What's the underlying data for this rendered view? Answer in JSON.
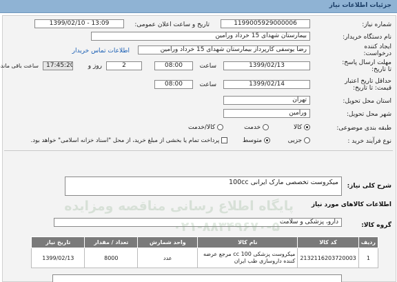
{
  "header": {
    "title": "جزئیات اطلاعات نیاز"
  },
  "form": {
    "need_number_label": "شماره نیاز:",
    "need_number": "1199005929000006",
    "announce_label": "تاریخ و ساعت اعلان عمومی:",
    "announce_value": "1399/02/10 - 13:09",
    "buyer_org_label": "نام دستگاه خریدار:",
    "buyer_org": "بیمارستان شهدای 15 خرداد ورامین",
    "creator_label_1": "ایجاد کننده",
    "creator_label_2": "درخواست:",
    "creator": "رضا یوسفی کارپرداز بیمارستان شهدای 15 خرداد ورامین",
    "contact_link": "اطلاعات تماس خریدار",
    "deadline_label_1": "مهلت ارسال پاسخ:",
    "deadline_label_2": "تا تاریخ:",
    "deadline_date": "1399/02/13",
    "time_label": "ساعت",
    "deadline_time": "08:00",
    "days": "2",
    "days_label": "روز و",
    "remaining_time": "17:45:20",
    "remaining_label": "ساعت باقی مانده",
    "validity_label_1": "حداقل تاریخ اعتبار",
    "validity_label_2": "قیمت: تا تاریخ:",
    "validity_date": "1399/02/14",
    "validity_time_label": "ساعت",
    "validity_time": "08:00",
    "province_label": "استان محل تحویل:",
    "province": "تهران",
    "city_label": "شهر محل تحویل:",
    "city": "ورامین",
    "category_label": "طبقه بندی موضوعی:",
    "category_options": [
      "کالا",
      "خدمت",
      "کالا/خدمت"
    ],
    "process_label": "نوع فرآیند خرید :",
    "process_options": [
      "جزیی",
      "متوسط"
    ],
    "payment_note": "پرداخت تمام یا بخشی از مبلغ خرید، از محل \"اسناد خزانه اسلامی\" خواهد بود."
  },
  "summary": {
    "label": "شرح کلی نیاز:",
    "value": "میکروست تخصصی مارک ایرانی 100cc"
  },
  "goods": {
    "section_title": "اطلاعات کالاهای مورد نیاز",
    "group_label": "گروه کالا:",
    "group_value": "دارو، پزشکی و سلامت",
    "columns": [
      "ردیف",
      "کد کالا",
      "نام کالا",
      "واحد شمارش",
      "تعداد / مقدار",
      "تاریخ نیاز"
    ],
    "rows": [
      {
        "index": "1",
        "code": "2132116203720003",
        "name": "میکروست پزشکی 100 cc مرجع عرضه کننده داروسازی طب ایران",
        "unit": "عدد",
        "qty": "8000",
        "date": "1399/02/13"
      }
    ]
  },
  "watermark": {
    "line1": "پایگاه اطلاع رسانی مناقصه ومزایده",
    "line2": "۰۲۱-۸۸۳۴۹۶۷۰-۵"
  }
}
